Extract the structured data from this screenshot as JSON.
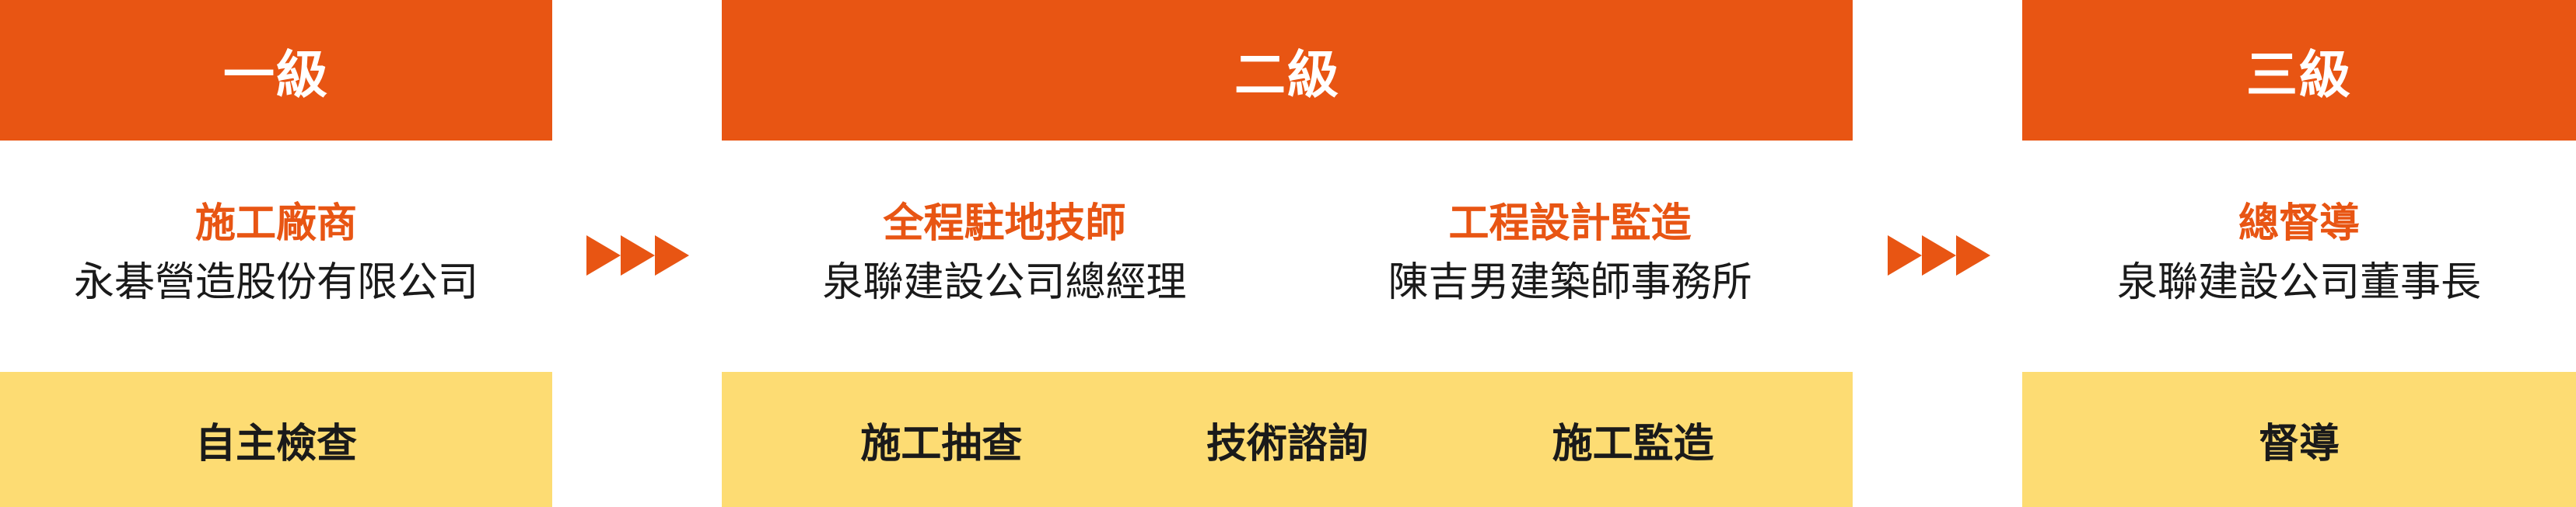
{
  "colors": {
    "header_bg": "#e85513",
    "header_text": "#ffffff",
    "role_text": "#e85513",
    "org_text": "#1a1a1a",
    "duty_bg": "#fddc73",
    "arrow": "#e85513"
  },
  "levels": [
    {
      "title": "一級",
      "parties": [
        {
          "role": "施工廠商",
          "org": "永碁營造股份有限公司"
        }
      ],
      "duties": [
        "自主檢查"
      ]
    },
    {
      "title": "二級",
      "parties": [
        {
          "role": "全程駐地技師",
          "org": "泉聯建設公司總經理"
        },
        {
          "role": "工程設計監造",
          "org": "陳吉男建築師事務所"
        }
      ],
      "duties": [
        "施工抽查",
        "技術諮詢",
        "施工監造"
      ]
    },
    {
      "title": "三級",
      "parties": [
        {
          "role": "總督導",
          "org": "泉聯建設公司董事長"
        }
      ],
      "duties": [
        "督導"
      ]
    }
  ]
}
